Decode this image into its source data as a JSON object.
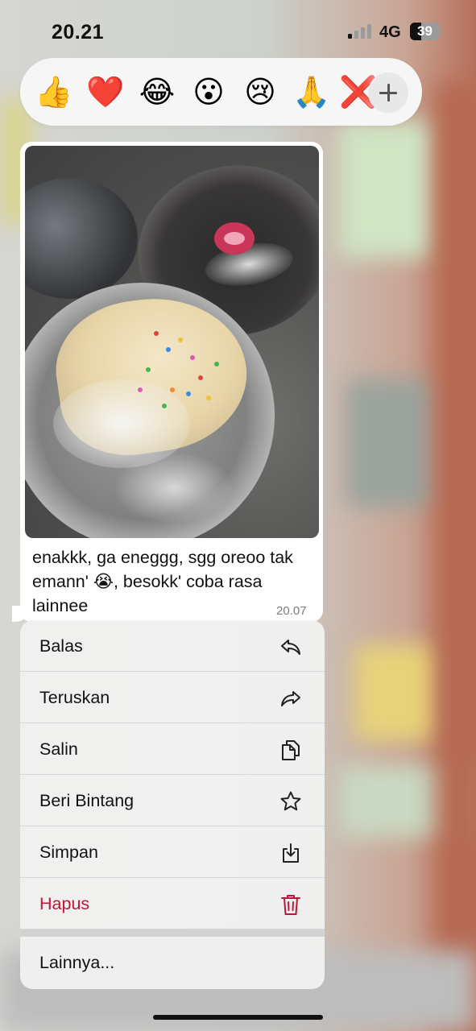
{
  "status_bar": {
    "time": "20.21",
    "network": "4G",
    "battery": "39",
    "battery_level": 0.39
  },
  "reactions": {
    "emojis": [
      "👍",
      "❤️",
      "😂",
      "😮",
      "😢",
      "🙏",
      "❌"
    ],
    "more_icon": "plus-icon"
  },
  "message": {
    "image_icon": "photo",
    "text": "enakkk, ga eneggg, sgg oreoo tak emann' 😭, besokk' coba rasa lainnee",
    "time": "20.07"
  },
  "menu": {
    "items": [
      {
        "label": "Balas",
        "icon": "reply-icon"
      },
      {
        "label": "Teruskan",
        "icon": "forward-icon"
      },
      {
        "label": "Salin",
        "icon": "copy-icon"
      },
      {
        "label": "Beri Bintang",
        "icon": "star-icon"
      },
      {
        "label": "Simpan",
        "icon": "save-icon"
      },
      {
        "label": "Hapus",
        "icon": "trash-icon"
      }
    ],
    "more_label": "Lainnya...",
    "danger_color": "#c0163a"
  }
}
